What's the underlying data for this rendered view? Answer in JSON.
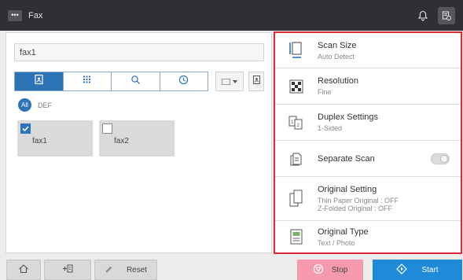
{
  "topbar": {
    "menu_label": "•••",
    "title": "Fax",
    "icons": [
      "bell-icon",
      "job-list-icon"
    ]
  },
  "destination": {
    "field_value": "fax1"
  },
  "tabs": [
    {
      "icon": "address-book-icon",
      "active": true
    },
    {
      "icon": "keypad-icon",
      "active": false
    },
    {
      "icon": "search-icon",
      "active": false
    },
    {
      "icon": "history-clock-icon",
      "active": false
    }
  ],
  "view_select_icon": "list-view-icon",
  "view_extra_icon": "address-detail-icon",
  "index": {
    "all_label": "All",
    "def_label": "DEF"
  },
  "destinations": [
    {
      "name": "fax1",
      "checked": true
    },
    {
      "name": "fax2",
      "checked": false
    }
  ],
  "settings": [
    {
      "icon": "scan-size-icon",
      "label": "Scan Size",
      "value": "Auto Detect"
    },
    {
      "icon": "resolution-icon",
      "label": "Resolution",
      "value": "Fine"
    },
    {
      "icon": "duplex-icon",
      "label": "Duplex Settings",
      "value": "1-Sided"
    },
    {
      "icon": "separate-scan-icon",
      "label": "Separate Scan",
      "toggle_on": false
    },
    {
      "icon": "original-setting-icon",
      "label": "Original Setting",
      "value": "Thin Paper Original : OFF",
      "value2": "Z-Folded Original : OFF"
    },
    {
      "icon": "original-type-icon",
      "label": "Original Type",
      "value": "Text / Photo"
    }
  ],
  "bottombar": {
    "home_icon": "home-icon",
    "register_icon": "register-icon",
    "reset_label": "Reset",
    "stop_label": "Stop",
    "start_label": "Start"
  },
  "colors": {
    "accent": "#2d74b6",
    "highlight_border": "#d92b35",
    "stop": "#f59aae",
    "start": "#1e8ad8"
  }
}
